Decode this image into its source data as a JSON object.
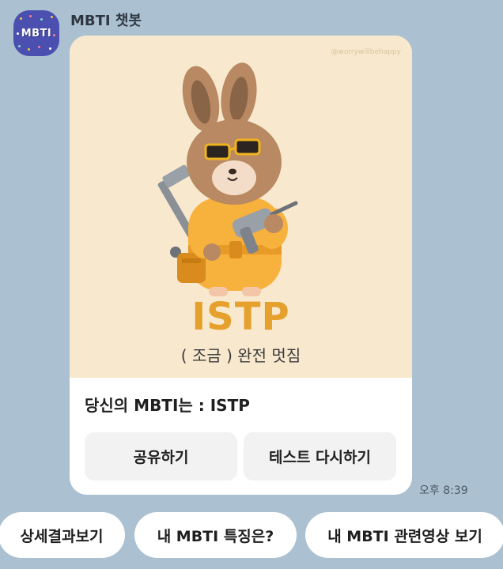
{
  "chat": {
    "sender_name": "MBTI 챗봇",
    "avatar_label": "MBTI",
    "time": "오후 8:39"
  },
  "card": {
    "watermark": "@worrywillbehappy",
    "type_title": "ISTP",
    "type_subtitle": "( 조금 ) 완전 멋짐",
    "result_text": "당신의 MBTI는 : ISTP",
    "share_label": "공유하기",
    "retest_label": "테스트 다시하기"
  },
  "quick_replies": {
    "detail_label": "상세결과보기",
    "traits_label": "내 MBTI 특징은?",
    "videos_label": "내 MBTI 관련영상 보기"
  },
  "colors": {
    "background": "#abc1d1",
    "card_image_bg": "#f8e9ce",
    "accent": "#e6a02d"
  }
}
